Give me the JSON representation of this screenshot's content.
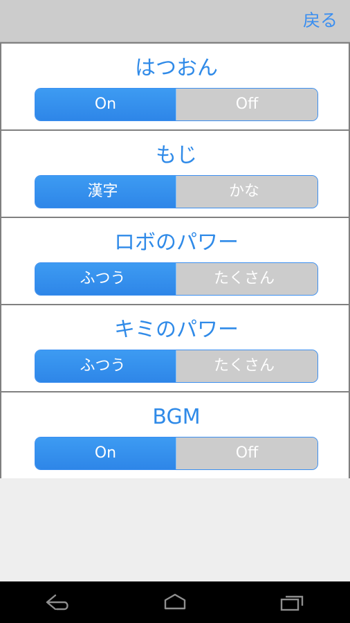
{
  "header": {
    "back_label": "戻る",
    "back_color": "#3a8ef0",
    "background_color": "#cccccc"
  },
  "theme": {
    "accent_blue": "#2f8ae8",
    "selected_segment_blue": "#3d9bf2",
    "unselected_segment_gray": "#cccccc",
    "card_background": "#ffffff",
    "card_border": "#808080",
    "page_background": "#eeeeee",
    "navbar_background": "#000000",
    "navbar_icon_color": "#8f8f8f"
  },
  "settings": [
    {
      "title": "はつおん",
      "options": [
        {
          "label": "On",
          "selected": true,
          "script": "latin"
        },
        {
          "label": "Off",
          "selected": false,
          "script": "latin"
        }
      ]
    },
    {
      "title": "もじ",
      "options": [
        {
          "label": "漢字",
          "selected": true,
          "script": "jp"
        },
        {
          "label": "かな",
          "selected": false,
          "script": "jp"
        }
      ]
    },
    {
      "title": "ロボのパワー",
      "options": [
        {
          "label": "ふつう",
          "selected": true,
          "script": "jp"
        },
        {
          "label": "たくさん",
          "selected": false,
          "script": "jp"
        }
      ]
    },
    {
      "title": "キミのパワー",
      "options": [
        {
          "label": "ふつう",
          "selected": true,
          "script": "jp"
        },
        {
          "label": "たくさん",
          "selected": false,
          "script": "jp"
        }
      ]
    },
    {
      "title": "BGM",
      "options": [
        {
          "label": "On",
          "selected": true,
          "script": "latin"
        },
        {
          "label": "Off",
          "selected": false,
          "script": "latin"
        }
      ]
    }
  ],
  "navbar": {
    "buttons": [
      {
        "icon": "back-arrow-icon",
        "name": "nav-back-button"
      },
      {
        "icon": "home-icon",
        "name": "nav-home-button"
      },
      {
        "icon": "recents-icon",
        "name": "nav-recents-button"
      }
    ]
  }
}
